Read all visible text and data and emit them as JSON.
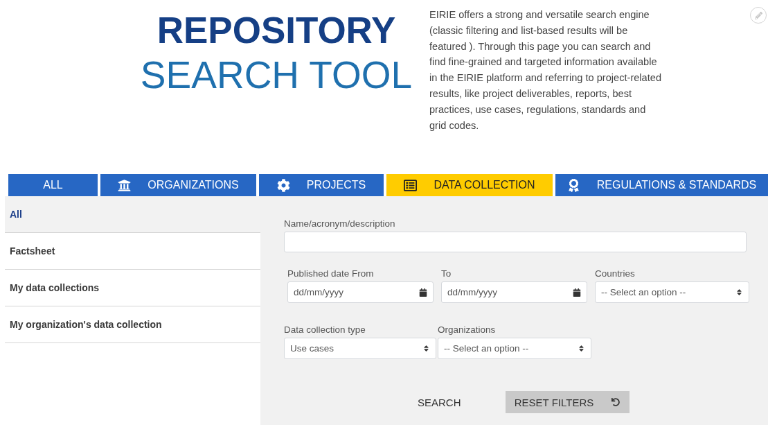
{
  "header": {
    "title_bold": "REPOSITORY",
    "title_light": "SEARCH TOOL",
    "description": "EIRIE offers a strong and versatile search engine (classic filtering and list-based results will be featured ). Through this page you can search and find fine-grained and targeted information available in the EIRIE platform and referring to project-related results, like project deliverables, reports, best practices, use cases, regulations, standards and grid codes."
  },
  "tabs": [
    {
      "label": "ALL",
      "kind": "plain",
      "selected": false
    },
    {
      "label": "ORGANIZATIONS",
      "kind": "bank",
      "selected": false
    },
    {
      "label": "PROJECTS",
      "kind": "gear",
      "selected": false
    },
    {
      "label": "DATA COLLECTION",
      "kind": "list",
      "selected": true
    },
    {
      "label": "REGULATIONS & STANDARDS",
      "kind": "award",
      "selected": false
    }
  ],
  "sidebar": {
    "items": [
      {
        "label": "All",
        "selected": true
      },
      {
        "label": "Factsheet",
        "selected": false
      },
      {
        "label": "My data collections",
        "selected": false
      },
      {
        "label": "My organization's data collection",
        "selected": false
      }
    ]
  },
  "form": {
    "name_field": {
      "label": "Name/acronym/description"
    },
    "date_from": {
      "label": "Published date From",
      "placeholder": "dd/mm/yyyy"
    },
    "date_to": {
      "label": "To",
      "placeholder": "dd/mm/yyyy"
    },
    "countries": {
      "label": "Countries",
      "value": "-- Select an option --"
    },
    "collection_type": {
      "label": "Data collection type",
      "value": "Use cases"
    },
    "organizations": {
      "label": "Organizations",
      "value": "-- Select an option --"
    }
  },
  "buttons": {
    "search": "SEARCH",
    "reset": "RESET FILTERS"
  }
}
